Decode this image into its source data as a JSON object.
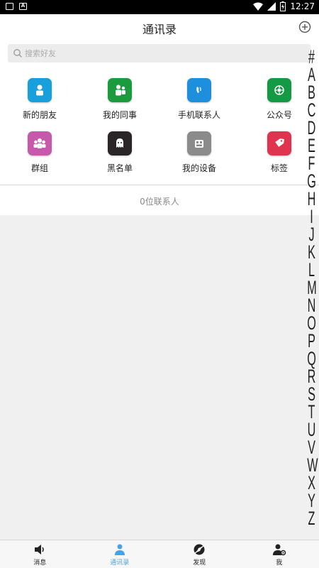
{
  "status_bar": {
    "time": "12:27"
  },
  "header": {
    "title": "通讯录"
  },
  "search": {
    "placeholder": "搜索好友"
  },
  "grid": [
    {
      "label": "新的朋友",
      "icon": "new-friend-icon",
      "color": "#1a9fdd"
    },
    {
      "label": "我的同事",
      "icon": "colleagues-icon",
      "color": "#1b9a3e"
    },
    {
      "label": "手机联系人",
      "icon": "phone-contacts-icon",
      "color": "#1e8fdc"
    },
    {
      "label": "公众号",
      "icon": "official-account-icon",
      "color": "#149a45"
    },
    {
      "label": "群组",
      "icon": "group-icon",
      "color": "#c45aa9"
    },
    {
      "label": "黑名单",
      "icon": "blacklist-icon",
      "color": "#2a2628"
    },
    {
      "label": "我的设备",
      "icon": "device-icon",
      "color": "#8b8b8b"
    },
    {
      "label": "标签",
      "icon": "tag-icon",
      "color": "#e0334f"
    }
  ],
  "contacts": {
    "count_text": "0位联系人"
  },
  "alphabet": [
    "#",
    "A",
    "B",
    "C",
    "D",
    "E",
    "F",
    "G",
    "H",
    "I",
    "J",
    "K",
    "L",
    "M",
    "N",
    "O",
    "P",
    "Q",
    "R",
    "S",
    "T",
    "U",
    "V",
    "W",
    "X",
    "Y",
    "Z"
  ],
  "tabs": [
    {
      "label": "消息",
      "icon": "speaker-icon",
      "active": false
    },
    {
      "label": "通讯录",
      "icon": "contacts-icon",
      "active": true
    },
    {
      "label": "发现",
      "icon": "discover-icon",
      "active": false
    },
    {
      "label": "我",
      "icon": "me-icon",
      "active": false
    }
  ],
  "colors": {
    "accent": "#4aa3e0"
  }
}
